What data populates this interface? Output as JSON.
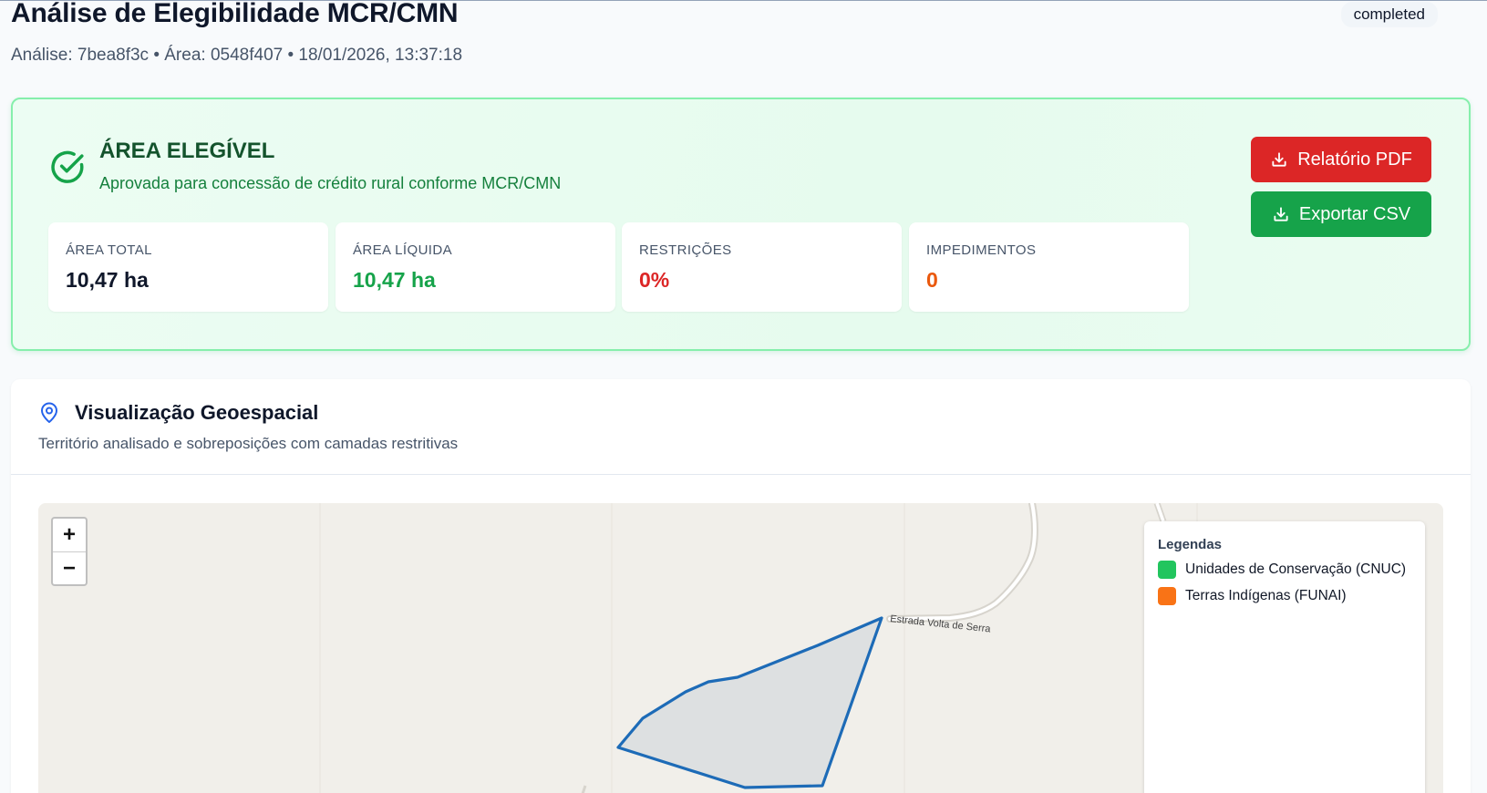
{
  "header": {
    "title": "Análise de Elegibilidade MCR/CMN",
    "subtitle": "Análise: 7bea8f3c • Área: 0548f407 • 18/01/2026, 13:37:18",
    "status": "completed"
  },
  "eligibility": {
    "title": "ÁREA ELEGÍVEL",
    "description": "Aprovada para concessão de crédito rural conforme MCR/CMN",
    "stats": [
      {
        "label": "ÁREA TOTAL",
        "value": "10,47 ha",
        "color": "#0f172a"
      },
      {
        "label": "ÁREA LÍQUIDA",
        "value": "10,47 ha",
        "color": "#16a34a"
      },
      {
        "label": "RESTRIÇÕES",
        "value": "0%",
        "color": "#dc2626"
      },
      {
        "label": "IMPEDIMENTOS",
        "value": "0",
        "color": "#ea580c"
      }
    ],
    "buttons": {
      "pdf_label": "Relatório PDF",
      "csv_label": "Exportar CSV"
    }
  },
  "geo": {
    "title": "Visualização Geoespacial",
    "description": "Território analisado e sobreposições com camadas restritivas",
    "map": {
      "road_label": "Estrada Volta de Serra",
      "zoom_in": "+",
      "zoom_out": "−",
      "legend": {
        "title": "Legendas",
        "items": [
          {
            "label": "Unidades de Conservação (CNUC)",
            "color": "#22c55e"
          },
          {
            "label": "Terras Indígenas (FUNAI)",
            "color": "#f97316"
          }
        ]
      }
    }
  },
  "icons": [
    "check-circle-icon",
    "download-icon",
    "map-pin-icon"
  ]
}
